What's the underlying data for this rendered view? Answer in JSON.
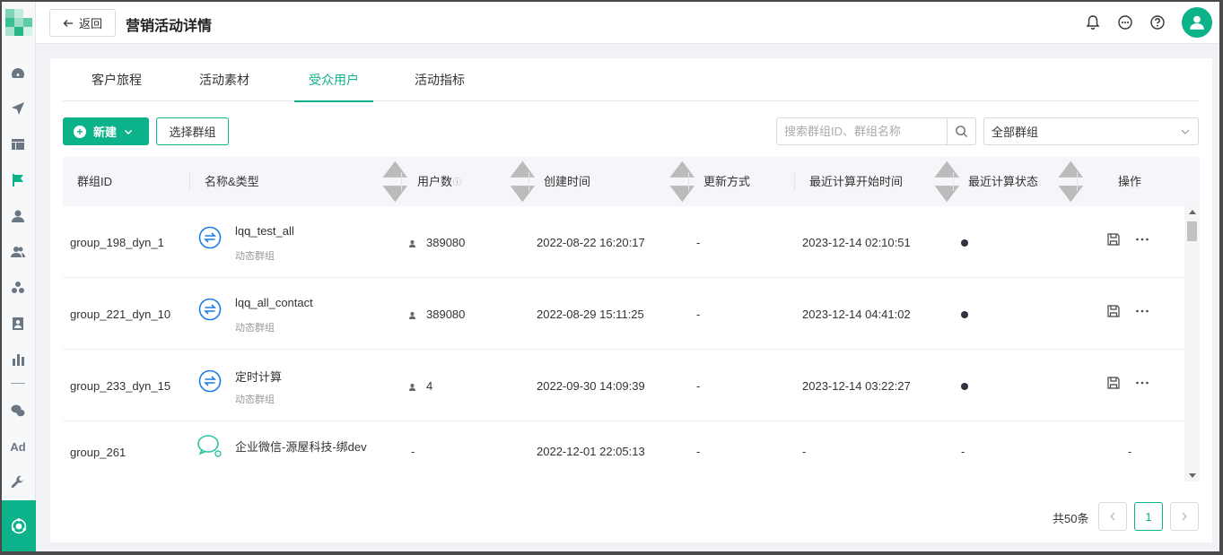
{
  "header": {
    "back_label": "返回",
    "title": "营销活动详情"
  },
  "tabs": [
    {
      "label": "客户旅程"
    },
    {
      "label": "活动素材"
    },
    {
      "label": "受众用户",
      "active": true
    },
    {
      "label": "活动指标"
    }
  ],
  "toolbar": {
    "new_label": "新建",
    "select_group_label": "选择群组",
    "search_placeholder": "搜索群组ID、群组名称",
    "group_filter_value": "全部群组"
  },
  "table": {
    "columns": [
      "群组ID",
      "名称&类型",
      "用户数",
      "创建时间",
      "更新方式",
      "最近计算开始时间",
      "最近计算状态",
      "操作"
    ],
    "rows": [
      {
        "id": "group_198_dyn_1",
        "name": "lqq_test_all",
        "type": "动态群组",
        "users": "389080",
        "created": "2022-08-22 16:20:17",
        "update_mode": "-",
        "last_calc": "2023-12-14 02:10:51",
        "status": "dot",
        "icon": "sync-icon"
      },
      {
        "id": "group_221_dyn_10",
        "name": "lqq_all_contact",
        "type": "动态群组",
        "users": "389080",
        "created": "2022-08-29 15:11:25",
        "update_mode": "-",
        "last_calc": "2023-12-14 04:41:02",
        "status": "dot",
        "icon": "sync-icon"
      },
      {
        "id": "group_233_dyn_15",
        "name": "定时计算",
        "type": "动态群组",
        "users": "4",
        "created": "2022-09-30 14:09:39",
        "update_mode": "-",
        "last_calc": "2023-12-14 03:22:27",
        "status": "dot",
        "icon": "sync-icon"
      },
      {
        "id": "group_261",
        "name": "企业微信-源屋科技-绑dev",
        "type": "",
        "users": "-",
        "created": "2022-12-01 22:05:13",
        "update_mode": "-",
        "last_calc": "-",
        "status": "-",
        "action": "-",
        "icon": "wecom-icon"
      }
    ]
  },
  "pagination": {
    "total_label": "共50条",
    "current_page": "1"
  },
  "colors": {
    "accent": "#0bb28a",
    "sync_icon": "#1a7ee6",
    "wecom_icon": "#2ec4a3"
  }
}
